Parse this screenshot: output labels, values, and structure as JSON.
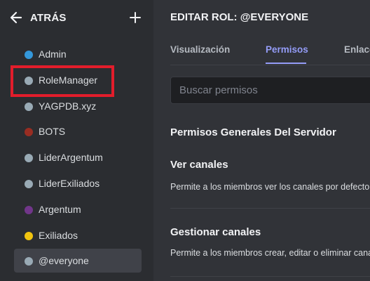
{
  "sidebar": {
    "back_label": "ATRÁS",
    "roles": [
      {
        "name": "Admin",
        "color": "#3498db"
      },
      {
        "name": "RoleManager",
        "color": "#99aab5"
      },
      {
        "name": "YAGPDB.xyz",
        "color": "#99aab5"
      },
      {
        "name": "BOTS",
        "color": "#992d22"
      },
      {
        "name": "LiderArgentum",
        "color": "#99aab5"
      },
      {
        "name": "LiderExiliados",
        "color": "#99aab5"
      },
      {
        "name": "Argentum",
        "color": "#71368a"
      },
      {
        "name": "Exiliados",
        "color": "#f1c40f"
      },
      {
        "name": "@everyone",
        "color": "#99aab5"
      }
    ],
    "selected_role": "@everyone"
  },
  "main": {
    "title": "EDITAR ROL: @EVERYONE",
    "tabs": [
      {
        "label": "Visualización",
        "active": false
      },
      {
        "label": "Permisos",
        "active": true
      },
      {
        "label": "Enlaces",
        "active": false
      }
    ],
    "search": {
      "placeholder": "Buscar permisos",
      "value": ""
    },
    "section_title": "Permisos Generales Del Servidor",
    "permissions": [
      {
        "title": "Ver canales",
        "description": "Permite a los miembros ver los canales por defecto"
      },
      {
        "title": "Gestionar canales",
        "description": "Permite a los miembros crear, editar o eliminar canales"
      }
    ]
  },
  "colors": {
    "accent": "#949cf7",
    "highlight": "#e21d2b"
  }
}
